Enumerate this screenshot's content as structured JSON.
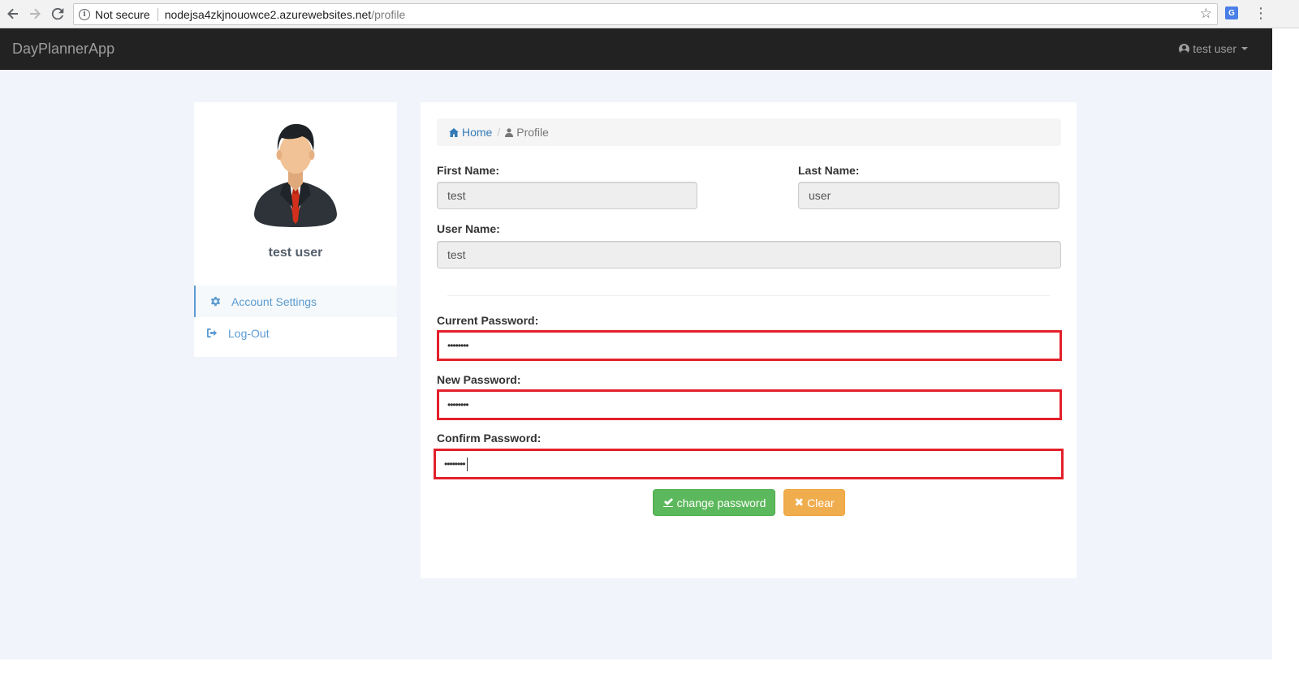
{
  "browser": {
    "security_label": "Not secure",
    "url_host": "nodejsa4zkjnouowce2.azurewebsites.net",
    "url_path": "/profile"
  },
  "navbar": {
    "brand": "DayPlannerApp",
    "user_label": "test user"
  },
  "profile_card": {
    "name": "test user",
    "menu": [
      {
        "label": "Account Settings",
        "icon": "gear-icon",
        "active": true
      },
      {
        "label": "Log-Out",
        "icon": "sign-out-icon",
        "active": false
      }
    ]
  },
  "breadcrumb": {
    "home": "Home",
    "current": "Profile"
  },
  "form": {
    "first_name_label": "First Name:",
    "first_name_value": "test",
    "last_name_label": "Last Name:",
    "last_name_value": "user",
    "user_name_label": "User Name:",
    "user_name_value": "test",
    "current_password_label": "Current Password:",
    "current_password_value": "••••••••",
    "new_password_label": "New Password:",
    "new_password_value": "••••••••",
    "confirm_password_label": "Confirm Password:",
    "confirm_password_value": "••••••••"
  },
  "buttons": {
    "change_password": "change password",
    "clear": "Clear"
  },
  "colors": {
    "navbar_bg": "#222222",
    "page_bg": "#f1f4fa",
    "link": "#337ab7",
    "success": "#5cb85c",
    "warning": "#f0ad4e",
    "highlight_border": "#e3202a"
  }
}
